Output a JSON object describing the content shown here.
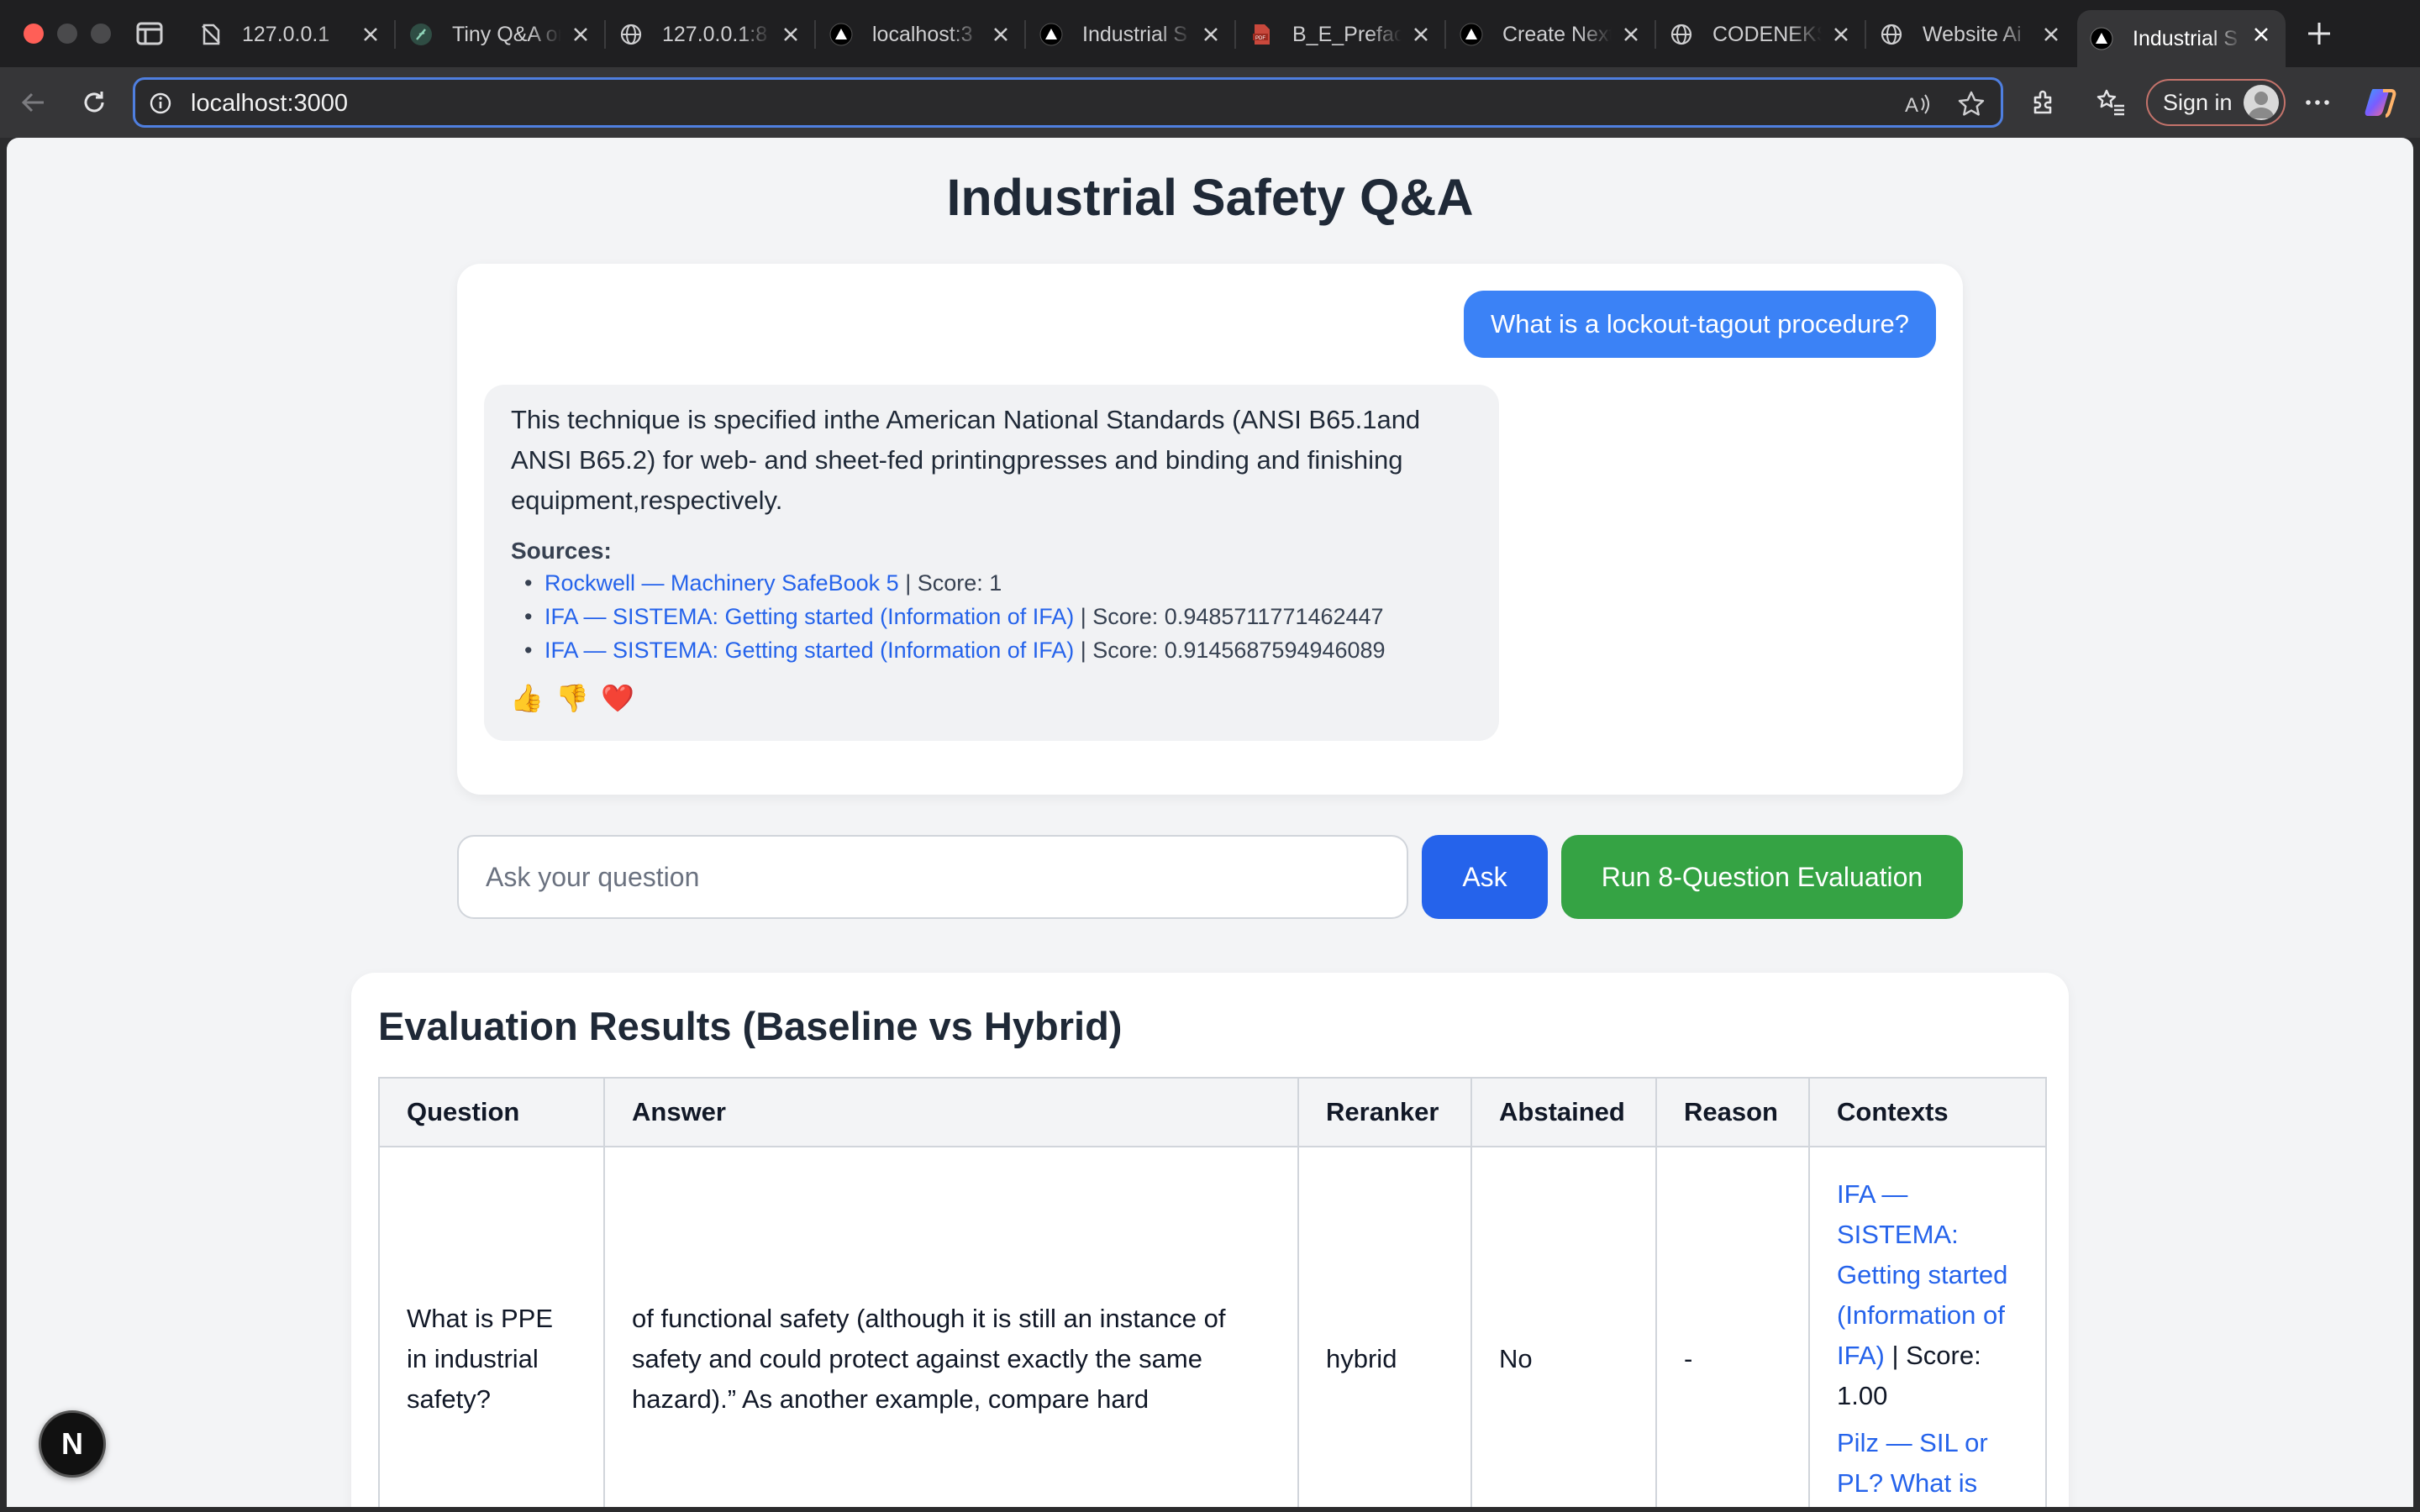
{
  "browser": {
    "tabs": [
      {
        "title": "127.0.0.1",
        "icon": "offline-page-icon"
      },
      {
        "title": "Tiny Q&A on",
        "icon": "feather-icon"
      },
      {
        "title": "127.0.0.1:8",
        "icon": "globe-icon"
      },
      {
        "title": "localhost:3",
        "icon": "triangle-icon"
      },
      {
        "title": "Industrial S",
        "icon": "triangle-icon"
      },
      {
        "title": "B_E_Preface",
        "icon": "pdf-icon"
      },
      {
        "title": "Create Next",
        "icon": "triangle-icon"
      },
      {
        "title": "CODENEKS",
        "icon": "globe-icon"
      },
      {
        "title": "Website Ai",
        "icon": "globe-icon"
      },
      {
        "title": "Industrial S",
        "icon": "triangle-icon",
        "active": true
      }
    ],
    "url": "localhost:3000",
    "signin_label": "Sign in",
    "accent_color": "#4f7fe0"
  },
  "page": {
    "title": "Industrial Safety Q&A"
  },
  "chat": {
    "user_message": "What is a lockout-tagout procedure?",
    "bot_message": "This technique is specified inthe American National Standards (ANSI B65.1and ANSI B65.2) for web- and sheet-fed printingpresses and binding and finishing equipment,respectively.",
    "sources_label": "Sources:",
    "sources": [
      {
        "title": "Rockwell — Machinery SafeBook 5",
        "score": "| Score: 1"
      },
      {
        "title": "IFA — SISTEMA: Getting started (Information of IFA)",
        "score": "| Score: 0.9485711771462447"
      },
      {
        "title": "IFA — SISTEMA: Getting started (Information of IFA)",
        "score": "| Score: 0.9145687594946089"
      }
    ],
    "reactions": [
      {
        "name": "thumbs-up-icon",
        "glyph": "👍"
      },
      {
        "name": "thumbs-down-icon",
        "glyph": "👎"
      },
      {
        "name": "heart-icon",
        "glyph": "❤️"
      }
    ]
  },
  "input": {
    "placeholder": "Ask your question",
    "value": "",
    "ask_label": "Ask",
    "eval_label": "Run 8-Question Evaluation",
    "ask_color": "#2563eb",
    "eval_color": "#35a344"
  },
  "evaluation": {
    "title": "Evaluation Results (Baseline vs Hybrid)",
    "columns": [
      "Question",
      "Answer",
      "Reranker",
      "Abstained",
      "Reason",
      "Contexts"
    ],
    "rows": [
      {
        "question": "What is PPE in industrial safety?",
        "answer": "of functional safety (although it is still an instance of safety and could protect against exactly the same hazard).” As another example, compare hard",
        "reranker": "hybrid",
        "abstained": "No",
        "reason": "-",
        "contexts": [
          {
            "title": "IFA — SISTEMA: Getting started (Information of IFA)",
            "score": "| Score: 1.00"
          },
          {
            "title": "Pilz — SIL or PL? What is the difference?",
            "score": ""
          }
        ]
      }
    ]
  },
  "dev_badge": {
    "label": "N"
  }
}
